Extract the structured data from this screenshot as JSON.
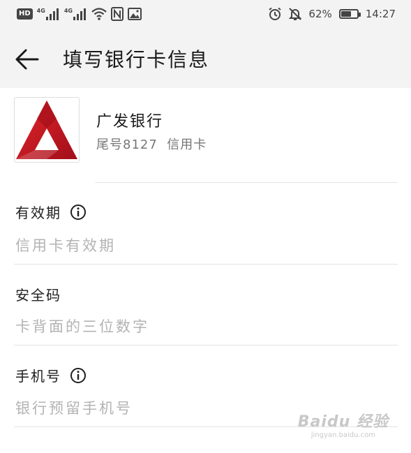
{
  "status_bar": {
    "hd_badge": "HD",
    "net1": "4G",
    "net2": "4G",
    "nfc": "N",
    "battery_percent_text": "62%",
    "battery_level": 0.62,
    "time": "14:27",
    "icons": [
      "wifi-icon",
      "nfc-icon",
      "image-icon",
      "alarm-icon",
      "bell-off-icon",
      "battery-icon"
    ]
  },
  "header": {
    "title": "填写银行卡信息"
  },
  "card": {
    "bank_name": "广发银行",
    "subtitle": "尾号8127  信用卡",
    "logo_color": "#c8102e"
  },
  "fields": {
    "expiry": {
      "label": "有效期",
      "placeholder": "信用卡有效期"
    },
    "cvv": {
      "label": "安全码",
      "placeholder": "卡背面的三位数字"
    },
    "phone": {
      "label": "手机号",
      "placeholder": "银行预留手机号"
    }
  },
  "watermark": {
    "main": "Baidu 经验",
    "sub": "jingyan.baidu.com"
  }
}
